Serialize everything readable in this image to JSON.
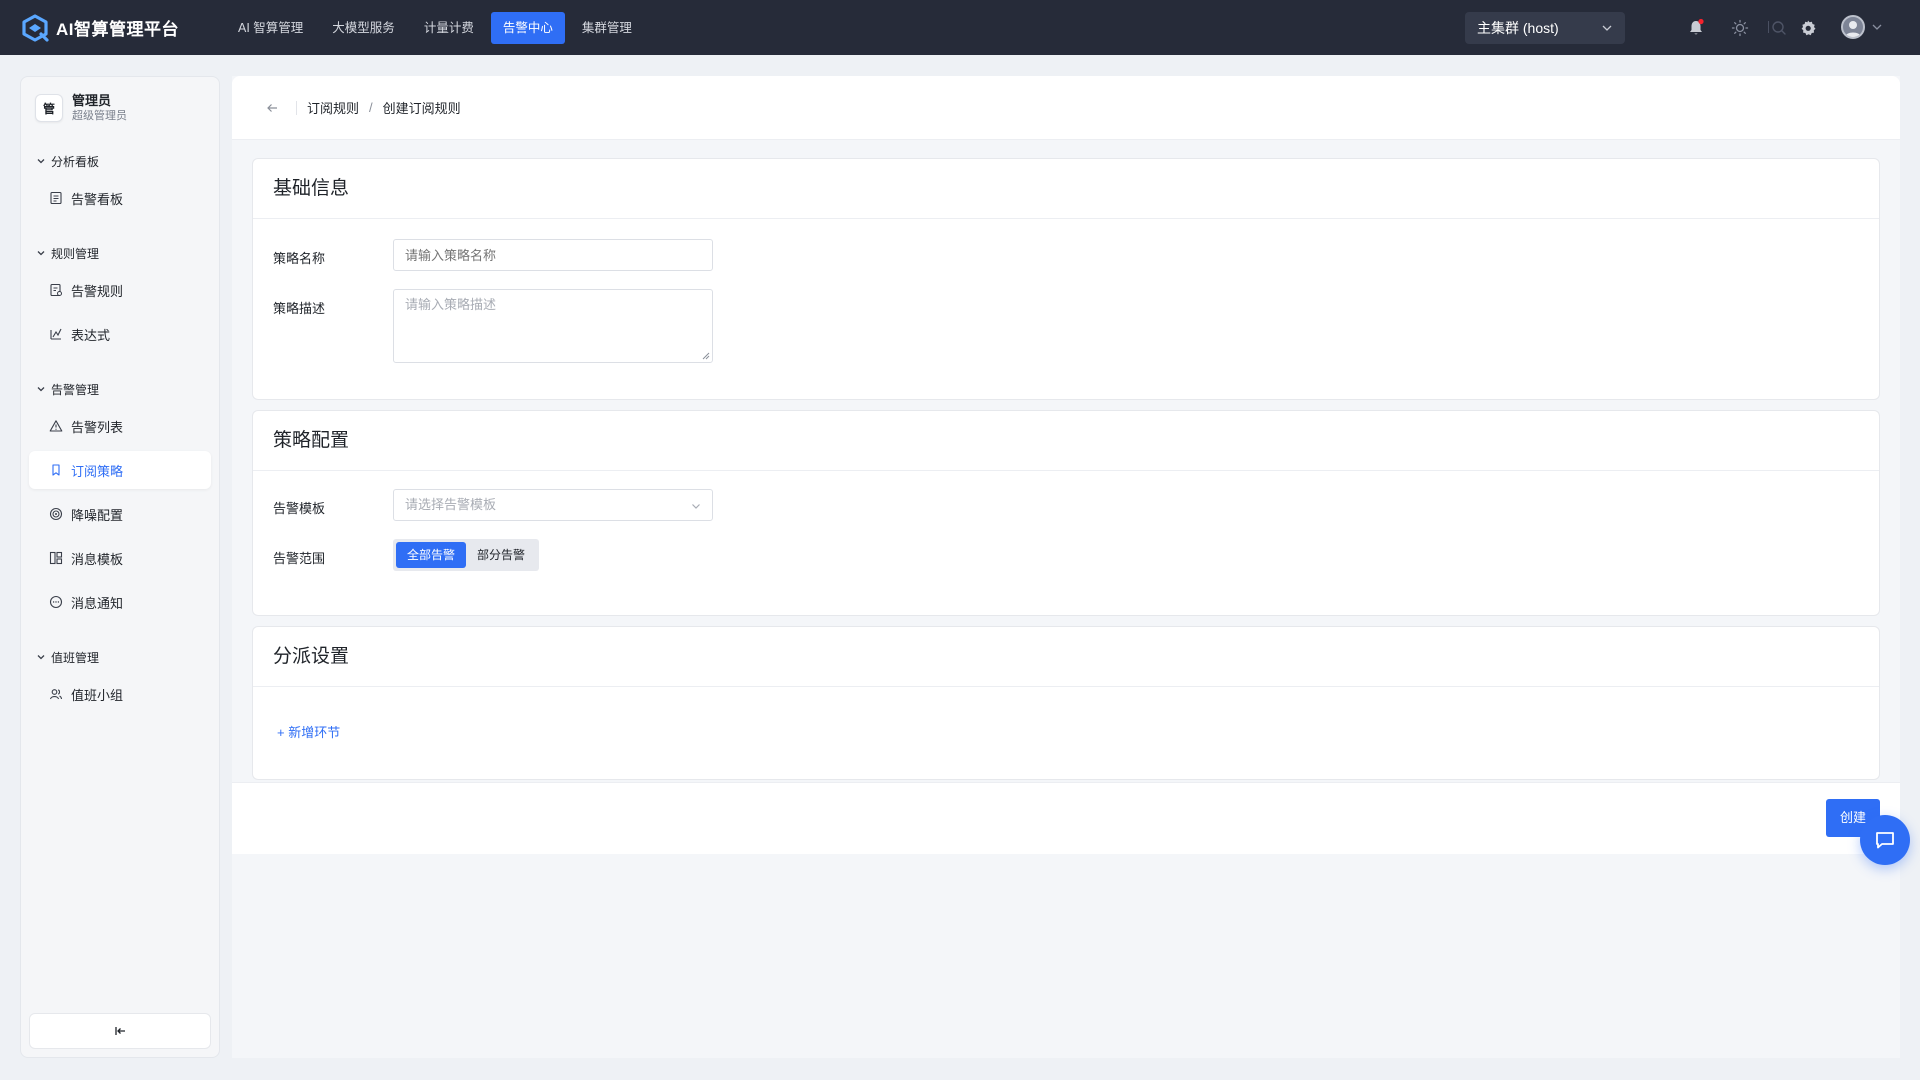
{
  "app": {
    "title": "AI智算管理平台"
  },
  "nav": {
    "items": [
      {
        "label": "AI 智算管理",
        "active": false
      },
      {
        "label": "大模型服务",
        "active": false
      },
      {
        "label": "计量计费",
        "active": false
      },
      {
        "label": "告警中心",
        "active": true
      },
      {
        "label": "集群管理",
        "active": false
      }
    ]
  },
  "topbar": {
    "cluster": "主集群 (host)",
    "icons": [
      "search-icon",
      "bell-icon",
      "sun-icon",
      "settings-icon",
      "avatar"
    ],
    "notification_dot_color": "#f5222d"
  },
  "user": {
    "badge": "管",
    "name": "管理员",
    "role": "超级管理员"
  },
  "sidebar": {
    "groups": [
      {
        "label": "分析看板",
        "items": [
          {
            "label": "告警看板",
            "icon": "dashboard-icon"
          }
        ]
      },
      {
        "label": "规则管理",
        "items": [
          {
            "label": "告警规则",
            "icon": "rule-icon"
          },
          {
            "label": "表达式",
            "icon": "expression-icon"
          }
        ]
      },
      {
        "label": "告警管理",
        "items": [
          {
            "label": "告警列表",
            "icon": "warning-icon"
          },
          {
            "label": "订阅策略",
            "icon": "bookmark-icon",
            "active": true
          },
          {
            "label": "降噪配置",
            "icon": "target-icon"
          },
          {
            "label": "消息模板",
            "icon": "template-icon"
          },
          {
            "label": "消息通知",
            "icon": "message-icon"
          }
        ]
      },
      {
        "label": "值班管理",
        "items": [
          {
            "label": "值班小组",
            "icon": "team-icon"
          }
        ]
      }
    ]
  },
  "breadcrumb": {
    "parent": "订阅规则",
    "separator": "/",
    "current": "创建订阅规则"
  },
  "form": {
    "basic": {
      "title": "基础信息",
      "name_label": "策略名称",
      "name_placeholder": "请输入策略名称",
      "desc_label": "策略描述",
      "desc_placeholder": "请输入策略描述"
    },
    "policy": {
      "title": "策略配置",
      "template_label": "告警模板",
      "template_placeholder": "请选择告警模板",
      "scope_label": "告警范围",
      "scope_options": [
        "全部告警",
        "部分告警"
      ],
      "scope_selected": "全部告警"
    },
    "dispatch": {
      "title": "分派设置",
      "add_link": "+ 新增环节"
    }
  },
  "footer": {
    "create_label": "创建"
  },
  "colors": {
    "primary": "#2f6ef5",
    "topbar": "#262b39"
  }
}
